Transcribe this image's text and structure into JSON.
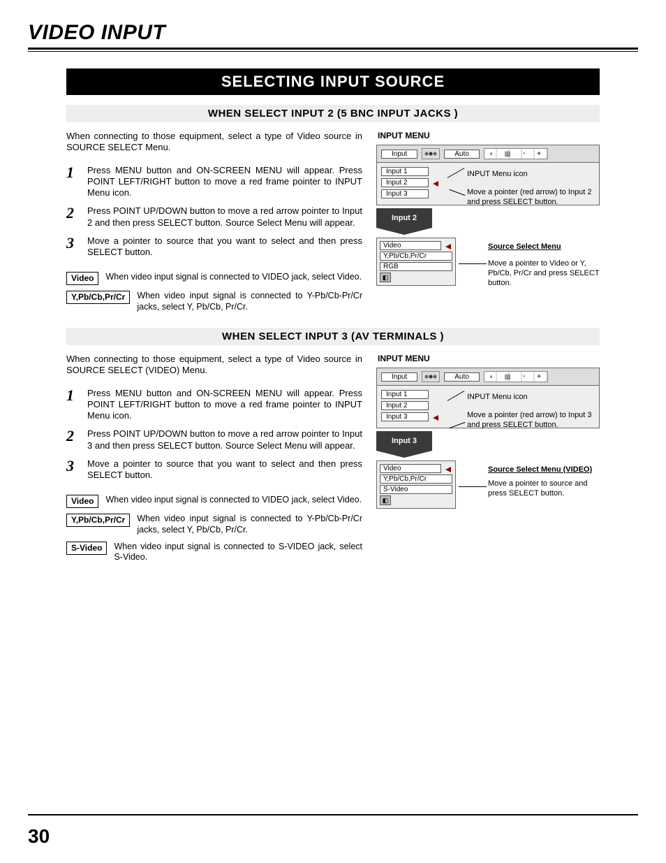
{
  "page": {
    "chapter": "VIDEO INPUT",
    "section": "SELECTING INPUT SOURCE",
    "number": "30"
  },
  "s1": {
    "header": "WHEN SELECT INPUT 2 (5 BNC INPUT JACKS )",
    "intro": "When connecting to those equipment, select a type of Video source in SOURCE SELECT Menu.",
    "step1": "Press MENU button and ON-SCREEN MENU will appear.  Press POINT LEFT/RIGHT button to move a red frame pointer to INPUT Menu icon.",
    "step2": "Press POINT UP/DOWN button to move a red arrow pointer to Input 2 and then press SELECT button.  Source Select Menu will appear.",
    "step3": "Move a pointer to source that you want to select and then press SELECT button.",
    "opt_video_label": "Video",
    "opt_video_text": "When video input signal is connected to VIDEO jack, select Video.",
    "opt_ypb_label": "Y,Pb/Cb,Pr/Cr",
    "opt_ypb_text": "When video input signal is connected to Y-Pb/Cb-Pr/Cr jacks, select Y, Pb/Cb, Pr/Cr.",
    "panel_title": "INPUT MENU",
    "menu_input_label": "Input",
    "menu_auto_label": "Auto",
    "inputs": [
      "Input 1",
      "Input 2",
      "Input 3"
    ],
    "annot_icon": "INPUT Menu icon",
    "annot_move": "Move a pointer (red arrow) to Input 2 and press SELECT button.",
    "arrow_label": "Input 2",
    "src_title": "Source Select Menu",
    "src_items": [
      "Video",
      "Y,Pb/Cb,Pr/Cr",
      "RGB"
    ],
    "src_annot": "Move a pointer to Video or Y, Pb/Cb, Pr/Cr and press SELECT button."
  },
  "s2": {
    "header": "WHEN SELECT INPUT 3 (AV TERMINALS )",
    "intro": "When connecting to those equipment, select a type of Video source in SOURCE SELECT (VIDEO) Menu.",
    "step1": "Press MENU button and ON-SCREEN MENU will appear.  Press POINT LEFT/RIGHT button to move a red frame pointer to INPUT Menu icon.",
    "step2": "Press POINT UP/DOWN button to move a red arrow pointer to Input 3 and then press SELECT button.  Source Select Menu will appear.",
    "step3": "Move a pointer to source that you want to select and then press SELECT button.",
    "opt_video_label": "Video",
    "opt_video_text": "When video input signal is connected to VIDEO jack, select Video.",
    "opt_ypb_label": "Y,Pb/Cb,Pr/Cr",
    "opt_ypb_text": "When video input signal is connected to Y-Pb/Cb-Pr/Cr jacks, select Y, Pb/Cb, Pr/Cr.",
    "opt_sv_label": "S-Video",
    "opt_sv_text": "When video input signal is connected to S-VIDEO jack, select S-Video.",
    "panel_title": "INPUT MENU",
    "menu_input_label": "Input",
    "menu_auto_label": "Auto",
    "inputs": [
      "Input 1",
      "Input 2",
      "Input 3"
    ],
    "annot_icon": "INPUT Menu icon",
    "annot_move": "Move a pointer (red arrow) to Input 3 and press SELECT button.",
    "arrow_label": "Input 3",
    "src_title": "Source Select Menu (VIDEO)",
    "src_items": [
      "Video",
      "Y,Pb/Cb,Pr/Cr",
      "S-Video"
    ],
    "src_annot": "Move a pointer to source and press SELECT button."
  },
  "nums": {
    "n1": "1",
    "n2": "2",
    "n3": "3"
  }
}
